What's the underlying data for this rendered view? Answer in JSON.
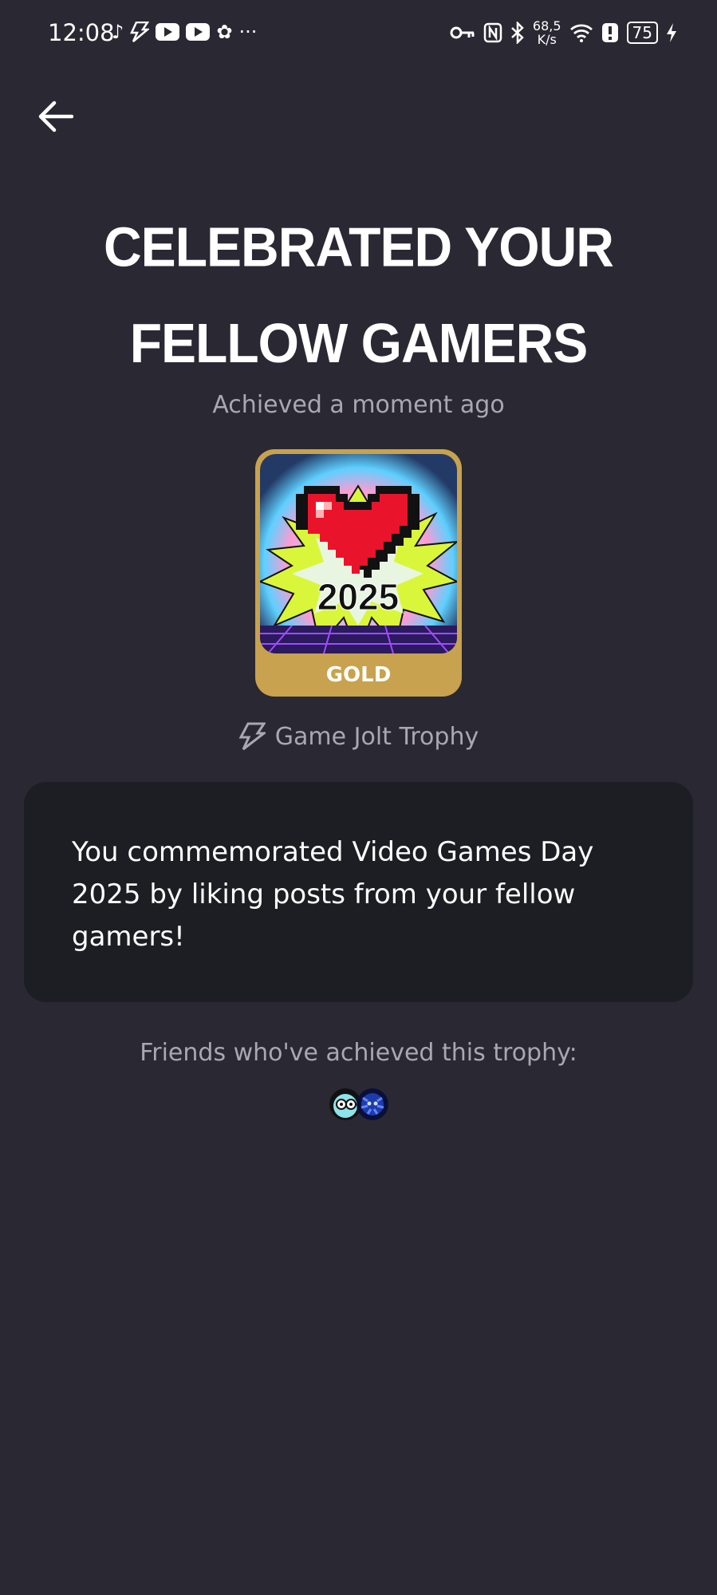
{
  "status_bar": {
    "time": "12:08",
    "netspeed_value": "68,5",
    "netspeed_unit": "K/s",
    "battery": "75",
    "left_icons": [
      "tiktok-icon",
      "gamejolt-icon",
      "youtube-icon",
      "youtube-icon",
      "settings-icon",
      "more-icon"
    ],
    "right_icons": [
      "key-icon",
      "nfc-icon",
      "bluetooth-icon",
      "wifi-icon",
      "alert-icon",
      "battery-icon",
      "charging-icon"
    ]
  },
  "header": {
    "back_icon": "arrow-left-icon"
  },
  "trophy": {
    "title": "CELEBRATED YOUR FELLOW GAMERS",
    "achieved": "Achieved a moment ago",
    "image_year": "2025",
    "tier": "GOLD",
    "tier_color": "#c8a24e",
    "source": "Game Jolt Trophy",
    "source_icon": "gamejolt-icon",
    "description": "You commemorated Video Games Day 2025 by liking posts from your fellow gamers!"
  },
  "friends": {
    "label": "Friends who've achieved this trophy:",
    "avatars": [
      "friend-avatar-1",
      "friend-avatar-2"
    ]
  },
  "colors": {
    "background": "#2a2832",
    "card": "#1d1d24",
    "muted_text": "#a9a7b2",
    "gold": "#c8a24e"
  }
}
